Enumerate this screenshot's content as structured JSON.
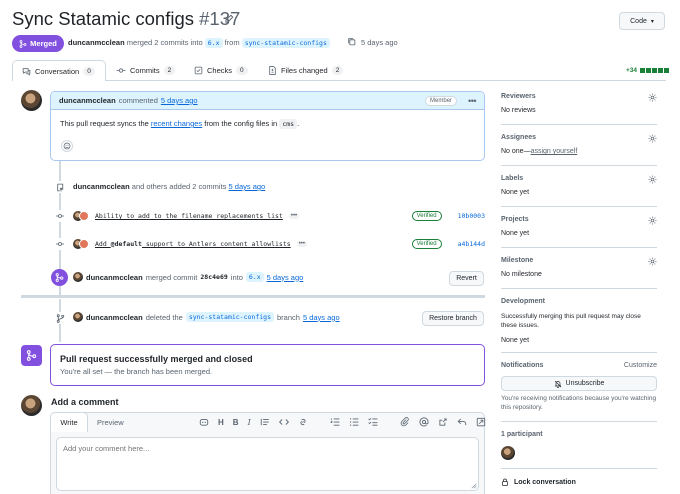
{
  "header": {
    "title": "Sync Statamic configs",
    "number": "#137",
    "code_button": "Code",
    "state_badge": "Merged",
    "author": "duncanmcclean",
    "merge_text": "merged 2 commits into",
    "base_branch": "6.x",
    "from_text": "from",
    "head_branch": "sync-statamic-configs",
    "time": "5 days ago"
  },
  "tabs": [
    {
      "label": "Conversation",
      "count": "0"
    },
    {
      "label": "Commits",
      "count": "2"
    },
    {
      "label": "Checks",
      "count": "0"
    },
    {
      "label": "Files changed",
      "count": "2"
    }
  ],
  "diffstat": "+34",
  "colors": {
    "merged": "#8250df",
    "added": "#1a7f37",
    "link": "#0969da"
  },
  "comment": {
    "author": "duncanmcclean",
    "action": "commented",
    "time": "5 days ago",
    "role_badge": "Member",
    "body_before": "This pull request syncs the",
    "body_link": "recent changes",
    "body_middle": "from the config files in",
    "body_code": "cms",
    "body_end": "."
  },
  "commits_event": {
    "author": "duncanmcclean",
    "text": "and others added 2 commits",
    "time": "5 days ago"
  },
  "commits": [
    {
      "message_pre": "Ability to add to the filename replacements list",
      "message_code": "",
      "message_post": "",
      "verified": "Verified",
      "sha": "10b0003"
    },
    {
      "message_pre": "Add ",
      "message_code": "@default",
      "message_post": " support to Antlers content allowlists",
      "verified": "Verified",
      "sha": "a4b144d"
    }
  ],
  "merge_event": {
    "author": "duncanmcclean",
    "text": "merged commit",
    "sha": "28c4e69",
    "into": "into",
    "branch": "6.x",
    "time": "5 days ago",
    "button": "Revert"
  },
  "delete_event": {
    "author": "duncanmcclean",
    "text": "deleted the",
    "branch": "sync-statamic-configs",
    "branch_word": "branch",
    "time": "5 days ago",
    "button": "Restore branch"
  },
  "merged_box": {
    "title": "Pull request successfully merged and closed",
    "subtitle": "You're all set — the branch has been merged."
  },
  "add_comment": {
    "heading": "Add a comment",
    "tab_write": "Write",
    "tab_preview": "Preview",
    "placeholder": "Add your comment here..."
  },
  "sidebar": {
    "reviewers": {
      "label": "Reviewers",
      "value": "No reviews"
    },
    "assignees": {
      "label": "Assignees",
      "value": "No one—",
      "link": "assign yourself"
    },
    "labels": {
      "label": "Labels",
      "value": "None yet"
    },
    "projects": {
      "label": "Projects",
      "value": "None yet"
    },
    "milestone": {
      "label": "Milestone",
      "value": "No milestone"
    },
    "development": {
      "label": "Development",
      "text": "Successfully merging this pull request may close these issues.",
      "value": "None yet"
    },
    "notifications": {
      "label": "Notifications",
      "customize": "Customize",
      "button": "Unsubscribe",
      "text": "You're receiving notifications because you're watching this repository."
    },
    "participants": {
      "label": "1 participant"
    },
    "lock": {
      "label": "Lock conversation"
    }
  }
}
